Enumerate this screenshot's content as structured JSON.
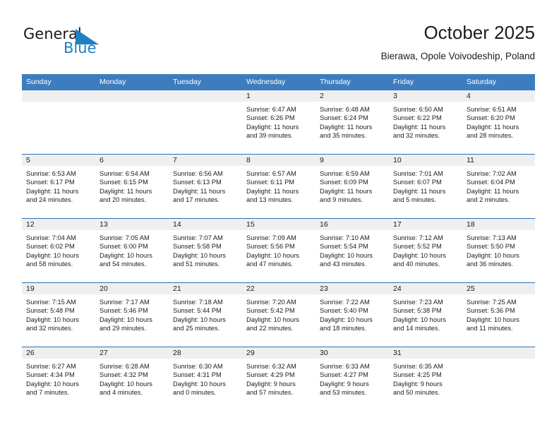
{
  "brand": {
    "word1": "General",
    "word2": "Blue",
    "triangle_color": "#1f7fc4",
    "blue_color": "#1f7fc4"
  },
  "header": {
    "title": "October 2025",
    "subtitle": "Bierawa, Opole Voivodeship, Poland"
  },
  "theme": {
    "header_row_bg": "#3d7dbf",
    "row_divider": "#2f6fb0",
    "daynum_strip_bg": "#efefef",
    "text": "#1c1c1c"
  },
  "calendar": {
    "weekday_headers": [
      "Sunday",
      "Monday",
      "Tuesday",
      "Wednesday",
      "Thursday",
      "Friday",
      "Saturday"
    ],
    "weeks": [
      [
        {
          "day": "",
          "sunrise": "",
          "sunset": "",
          "daylight_line1": "",
          "daylight_line2": ""
        },
        {
          "day": "",
          "sunrise": "",
          "sunset": "",
          "daylight_line1": "",
          "daylight_line2": ""
        },
        {
          "day": "",
          "sunrise": "",
          "sunset": "",
          "daylight_line1": "",
          "daylight_line2": ""
        },
        {
          "day": "1",
          "sunrise": "Sunrise: 6:47 AM",
          "sunset": "Sunset: 6:26 PM",
          "daylight_line1": "Daylight: 11 hours",
          "daylight_line2": "and 39 minutes."
        },
        {
          "day": "2",
          "sunrise": "Sunrise: 6:48 AM",
          "sunset": "Sunset: 6:24 PM",
          "daylight_line1": "Daylight: 11 hours",
          "daylight_line2": "and 35 minutes."
        },
        {
          "day": "3",
          "sunrise": "Sunrise: 6:50 AM",
          "sunset": "Sunset: 6:22 PM",
          "daylight_line1": "Daylight: 11 hours",
          "daylight_line2": "and 32 minutes."
        },
        {
          "day": "4",
          "sunrise": "Sunrise: 6:51 AM",
          "sunset": "Sunset: 6:20 PM",
          "daylight_line1": "Daylight: 11 hours",
          "daylight_line2": "and 28 minutes."
        }
      ],
      [
        {
          "day": "5",
          "sunrise": "Sunrise: 6:53 AM",
          "sunset": "Sunset: 6:17 PM",
          "daylight_line1": "Daylight: 11 hours",
          "daylight_line2": "and 24 minutes."
        },
        {
          "day": "6",
          "sunrise": "Sunrise: 6:54 AM",
          "sunset": "Sunset: 6:15 PM",
          "daylight_line1": "Daylight: 11 hours",
          "daylight_line2": "and 20 minutes."
        },
        {
          "day": "7",
          "sunrise": "Sunrise: 6:56 AM",
          "sunset": "Sunset: 6:13 PM",
          "daylight_line1": "Daylight: 11 hours",
          "daylight_line2": "and 17 minutes."
        },
        {
          "day": "8",
          "sunrise": "Sunrise: 6:57 AM",
          "sunset": "Sunset: 6:11 PM",
          "daylight_line1": "Daylight: 11 hours",
          "daylight_line2": "and 13 minutes."
        },
        {
          "day": "9",
          "sunrise": "Sunrise: 6:59 AM",
          "sunset": "Sunset: 6:09 PM",
          "daylight_line1": "Daylight: 11 hours",
          "daylight_line2": "and 9 minutes."
        },
        {
          "day": "10",
          "sunrise": "Sunrise: 7:01 AM",
          "sunset": "Sunset: 6:07 PM",
          "daylight_line1": "Daylight: 11 hours",
          "daylight_line2": "and 5 minutes."
        },
        {
          "day": "11",
          "sunrise": "Sunrise: 7:02 AM",
          "sunset": "Sunset: 6:04 PM",
          "daylight_line1": "Daylight: 11 hours",
          "daylight_line2": "and 2 minutes."
        }
      ],
      [
        {
          "day": "12",
          "sunrise": "Sunrise: 7:04 AM",
          "sunset": "Sunset: 6:02 PM",
          "daylight_line1": "Daylight: 10 hours",
          "daylight_line2": "and 58 minutes."
        },
        {
          "day": "13",
          "sunrise": "Sunrise: 7:05 AM",
          "sunset": "Sunset: 6:00 PM",
          "daylight_line1": "Daylight: 10 hours",
          "daylight_line2": "and 54 minutes."
        },
        {
          "day": "14",
          "sunrise": "Sunrise: 7:07 AM",
          "sunset": "Sunset: 5:58 PM",
          "daylight_line1": "Daylight: 10 hours",
          "daylight_line2": "and 51 minutes."
        },
        {
          "day": "15",
          "sunrise": "Sunrise: 7:09 AM",
          "sunset": "Sunset: 5:56 PM",
          "daylight_line1": "Daylight: 10 hours",
          "daylight_line2": "and 47 minutes."
        },
        {
          "day": "16",
          "sunrise": "Sunrise: 7:10 AM",
          "sunset": "Sunset: 5:54 PM",
          "daylight_line1": "Daylight: 10 hours",
          "daylight_line2": "and 43 minutes."
        },
        {
          "day": "17",
          "sunrise": "Sunrise: 7:12 AM",
          "sunset": "Sunset: 5:52 PM",
          "daylight_line1": "Daylight: 10 hours",
          "daylight_line2": "and 40 minutes."
        },
        {
          "day": "18",
          "sunrise": "Sunrise: 7:13 AM",
          "sunset": "Sunset: 5:50 PM",
          "daylight_line1": "Daylight: 10 hours",
          "daylight_line2": "and 36 minutes."
        }
      ],
      [
        {
          "day": "19",
          "sunrise": "Sunrise: 7:15 AM",
          "sunset": "Sunset: 5:48 PM",
          "daylight_line1": "Daylight: 10 hours",
          "daylight_line2": "and 32 minutes."
        },
        {
          "day": "20",
          "sunrise": "Sunrise: 7:17 AM",
          "sunset": "Sunset: 5:46 PM",
          "daylight_line1": "Daylight: 10 hours",
          "daylight_line2": "and 29 minutes."
        },
        {
          "day": "21",
          "sunrise": "Sunrise: 7:18 AM",
          "sunset": "Sunset: 5:44 PM",
          "daylight_line1": "Daylight: 10 hours",
          "daylight_line2": "and 25 minutes."
        },
        {
          "day": "22",
          "sunrise": "Sunrise: 7:20 AM",
          "sunset": "Sunset: 5:42 PM",
          "daylight_line1": "Daylight: 10 hours",
          "daylight_line2": "and 22 minutes."
        },
        {
          "day": "23",
          "sunrise": "Sunrise: 7:22 AM",
          "sunset": "Sunset: 5:40 PM",
          "daylight_line1": "Daylight: 10 hours",
          "daylight_line2": "and 18 minutes."
        },
        {
          "day": "24",
          "sunrise": "Sunrise: 7:23 AM",
          "sunset": "Sunset: 5:38 PM",
          "daylight_line1": "Daylight: 10 hours",
          "daylight_line2": "and 14 minutes."
        },
        {
          "day": "25",
          "sunrise": "Sunrise: 7:25 AM",
          "sunset": "Sunset: 5:36 PM",
          "daylight_line1": "Daylight: 10 hours",
          "daylight_line2": "and 11 minutes."
        }
      ],
      [
        {
          "day": "26",
          "sunrise": "Sunrise: 6:27 AM",
          "sunset": "Sunset: 4:34 PM",
          "daylight_line1": "Daylight: 10 hours",
          "daylight_line2": "and 7 minutes."
        },
        {
          "day": "27",
          "sunrise": "Sunrise: 6:28 AM",
          "sunset": "Sunset: 4:32 PM",
          "daylight_line1": "Daylight: 10 hours",
          "daylight_line2": "and 4 minutes."
        },
        {
          "day": "28",
          "sunrise": "Sunrise: 6:30 AM",
          "sunset": "Sunset: 4:31 PM",
          "daylight_line1": "Daylight: 10 hours",
          "daylight_line2": "and 0 minutes."
        },
        {
          "day": "29",
          "sunrise": "Sunrise: 6:32 AM",
          "sunset": "Sunset: 4:29 PM",
          "daylight_line1": "Daylight: 9 hours",
          "daylight_line2": "and 57 minutes."
        },
        {
          "day": "30",
          "sunrise": "Sunrise: 6:33 AM",
          "sunset": "Sunset: 4:27 PM",
          "daylight_line1": "Daylight: 9 hours",
          "daylight_line2": "and 53 minutes."
        },
        {
          "day": "31",
          "sunrise": "Sunrise: 6:35 AM",
          "sunset": "Sunset: 4:25 PM",
          "daylight_line1": "Daylight: 9 hours",
          "daylight_line2": "and 50 minutes."
        },
        {
          "day": "",
          "sunrise": "",
          "sunset": "",
          "daylight_line1": "",
          "daylight_line2": ""
        }
      ]
    ]
  }
}
